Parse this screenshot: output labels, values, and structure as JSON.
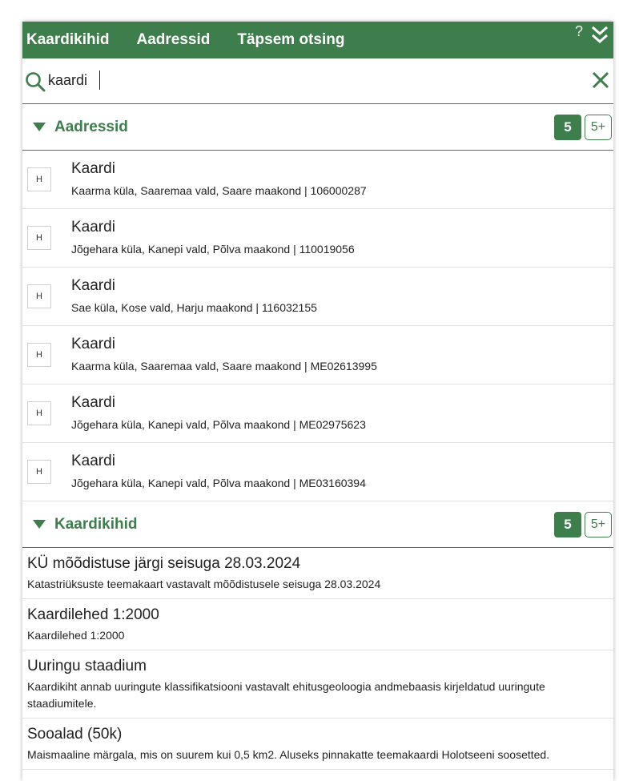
{
  "tabs": [
    "Kaardikihid",
    "Aadressid",
    "Täpsem otsing"
  ],
  "help_label": "?",
  "search": {
    "value": "kaardi"
  },
  "addresses": {
    "title": "Aadressid",
    "count": "5",
    "more": "5+",
    "items": [
      {
        "badge": "H",
        "name": "Kaardi",
        "detail": "Kaarma küla, Saaremaa vald, Saare maakond | 106000287"
      },
      {
        "badge": "H",
        "name": "Kaardi",
        "detail": "Jõgehara küla, Kanepi vald, Põlva maakond | 110019056"
      },
      {
        "badge": "H",
        "name": "Kaardi",
        "detail": "Sae küla, Kose vald, Harju maakond | 116032155"
      },
      {
        "badge": "H",
        "name": "Kaardi",
        "detail": "Kaarma küla, Saaremaa vald, Saare maakond | ME02613995"
      },
      {
        "badge": "H",
        "name": "Kaardi",
        "detail": "Jõgehara küla, Kanepi vald, Põlva maakond | ME02975623"
      },
      {
        "badge": "H",
        "name": "Kaardi",
        "detail": "Jõgehara küla, Kanepi vald, Põlva maakond | ME03160394"
      }
    ]
  },
  "layers": {
    "title": "Kaardikihid",
    "count": "5",
    "more": "5+",
    "items": [
      {
        "name": "KÜ mõõdistuse järgi seisuga 28.03.2024",
        "desc": "Katastriüksuste teemakaart vastavalt mõõdistusele seisuga 28.03.2024"
      },
      {
        "name": "Kaardilehed 1:2000",
        "desc": "Kaardilehed 1:2000"
      },
      {
        "name": "Uuringu staadium",
        "desc": "Kaardikiht annab uuringute klassifikatsiooni vastavalt ehitusgeoloogia andmebaasis kirjeldatud uuringute staadiumitele."
      },
      {
        "name": "Sooalad (50k)",
        "desc": "Maismaaline märgala, mis on suurem kui 0,5 km2. Aluseks pinnakatte teemakaardi Holotseeni soosetted."
      }
    ]
  },
  "colors": {
    "accent": "#3e7d4c",
    "header_text": "#ffffff"
  }
}
